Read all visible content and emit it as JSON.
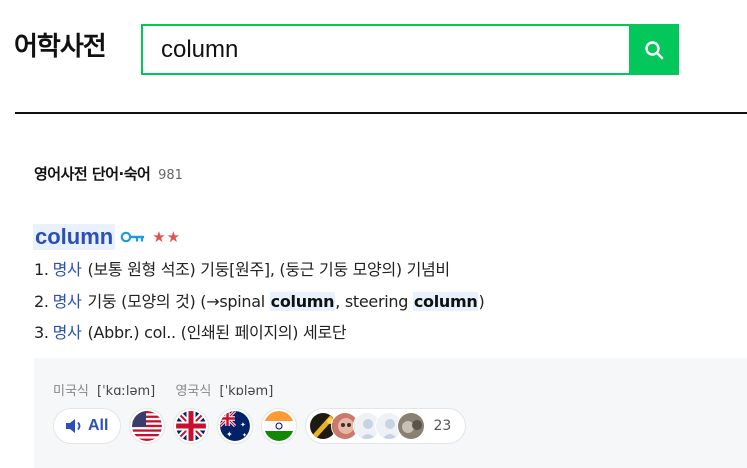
{
  "header": {
    "brand": "어학사전",
    "search_value": "column"
  },
  "section": {
    "title": "영어사전 단어·숙어",
    "count": "981"
  },
  "entry": {
    "headword": "column",
    "stars": "★★",
    "meanings": [
      {
        "num": "1.",
        "pos": "명사",
        "parts": [
          {
            "t": "(보통 원형 석조) 기둥[원주], (둥근 기둥 모양의) 기념비",
            "hl": false
          }
        ]
      },
      {
        "num": "2.",
        "pos": "명사",
        "parts": [
          {
            "t": "기둥 (모양의 것) (→spinal ",
            "hl": false
          },
          {
            "t": "column",
            "hl": true
          },
          {
            "t": ", steering ",
            "hl": false
          },
          {
            "t": "column",
            "hl": true
          },
          {
            "t": ")",
            "hl": false
          }
        ]
      },
      {
        "num": "3.",
        "pos": "명사",
        "parts": [
          {
            "t": "(Abbr.) col.. (인쇄된 페이지의) 세로단",
            "hl": false
          }
        ]
      }
    ]
  },
  "pronunciation": {
    "us_label": "미국식",
    "us_ipa": "[ˈkɑːləm]",
    "uk_label": "영국식",
    "uk_ipa": "[ˈkɒləm]",
    "all_label": "All",
    "flags": [
      "us-flag",
      "uk-flag",
      "au-flag",
      "in-flag"
    ],
    "user_count": "23"
  },
  "colors": {
    "accent": "#03c75a",
    "link": "#2b4fb8",
    "star": "#e0554d",
    "highlight": "#e8f1fd"
  }
}
